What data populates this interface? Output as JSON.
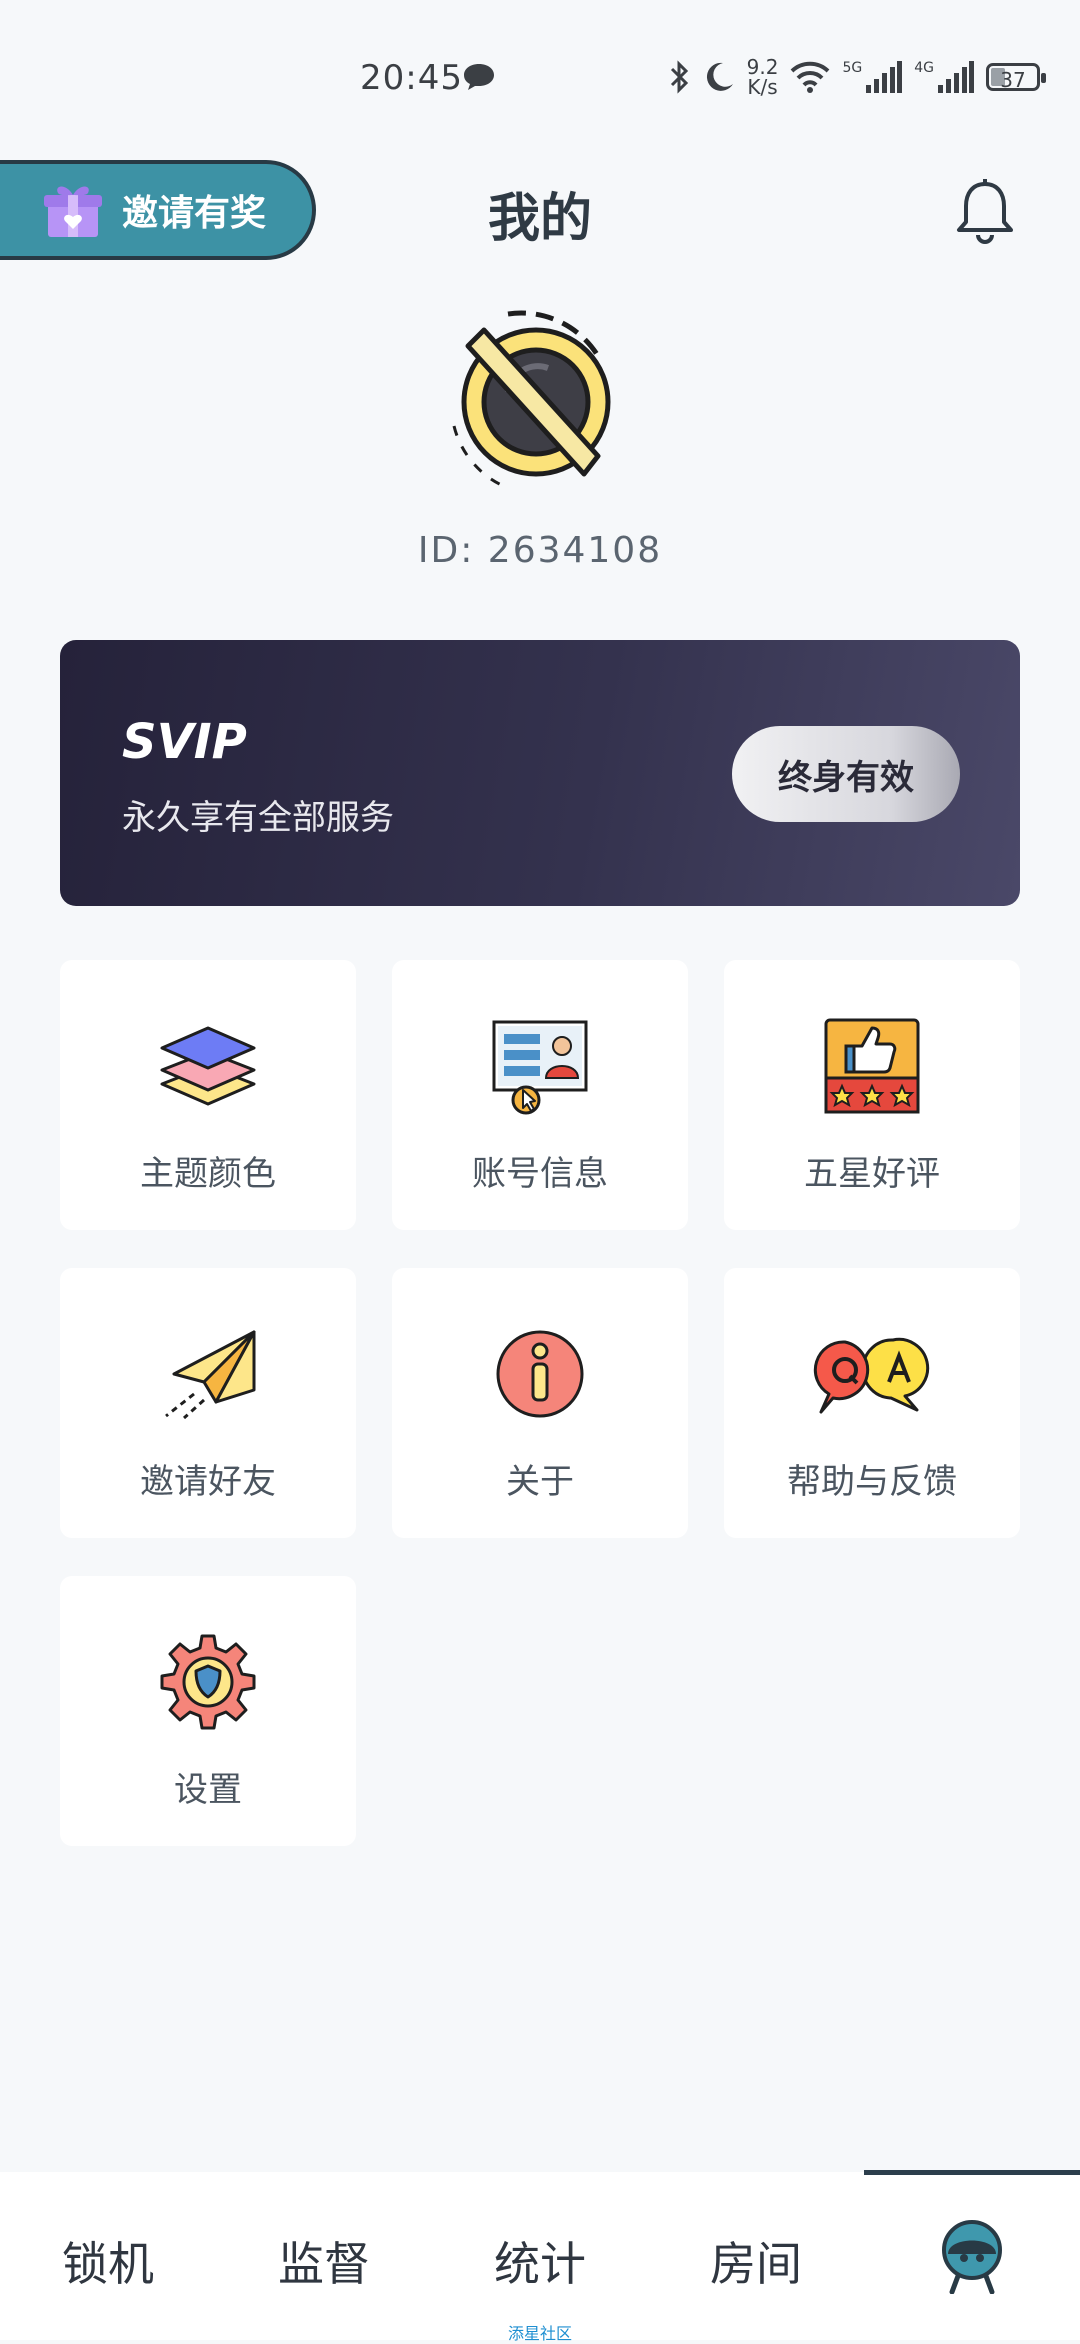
{
  "status_bar": {
    "time": "20:45",
    "net_speed_value": "9.2",
    "net_speed_unit": "K/s",
    "signal_1_label": "5G",
    "signal_2_label": "4G",
    "battery": "37",
    "icons": [
      "chat-bubble-icon",
      "bluetooth-icon",
      "moon-icon",
      "wifi-icon",
      "signal-icon",
      "battery-icon"
    ]
  },
  "header": {
    "invite_label": "邀请有奖",
    "title": "我的"
  },
  "profile": {
    "id_text": "ID: 2634108"
  },
  "svip": {
    "title": "SVIP",
    "subtitle": "永久享有全部服务",
    "badge": "终身有效"
  },
  "menu": {
    "items": [
      {
        "label": "主题颜色",
        "icon": "layers-icon"
      },
      {
        "label": "账号信息",
        "icon": "account-card-icon"
      },
      {
        "label": "五星好评",
        "icon": "thumbs-up-stars-icon"
      },
      {
        "label": "邀请好友",
        "icon": "paper-plane-icon"
      },
      {
        "label": "关于",
        "icon": "info-icon"
      },
      {
        "label": "帮助与反馈",
        "icon": "qa-bubbles-icon"
      },
      {
        "label": "设置",
        "icon": "gear-shield-icon"
      }
    ]
  },
  "bottom_nav": {
    "items": [
      "锁机",
      "监督",
      "统计",
      "房间"
    ],
    "watermark": "添星社区"
  },
  "colors": {
    "background": "#f6f8fa",
    "invite_pill": "#3d92a5",
    "svip_card": "#2d2b45",
    "nav_active": "#2c3e4c"
  }
}
